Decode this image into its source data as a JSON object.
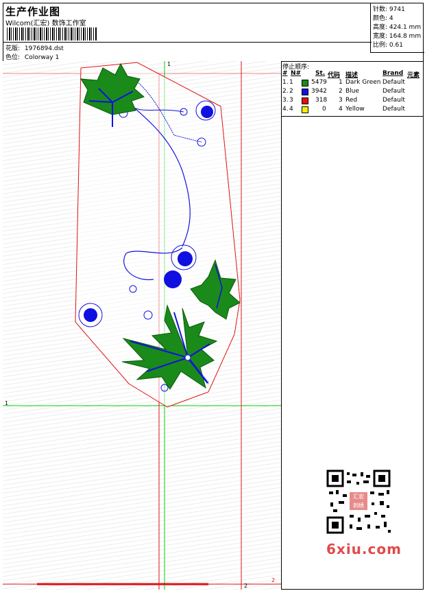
{
  "header": {
    "title": "生产作业图",
    "subtitle": "Wilcom(汇宏) 数饰工作室",
    "design_label": "花版:",
    "design_value": "1976894.dst",
    "colorway_label": "色位:",
    "colorway_value": "Colorway 1"
  },
  "stats": [
    {
      "label": "针数:",
      "value": "9741"
    },
    {
      "label": "颜色:",
      "value": "4"
    },
    {
      "label": "高度:",
      "value": "424.1 mm"
    },
    {
      "label": "宽度:",
      "value": "164.8 mm"
    },
    {
      "label": "比例:",
      "value": "0.61"
    }
  ],
  "legend": {
    "title": "停止顺序:",
    "columns": [
      "#",
      "N#",
      "St.",
      "代码",
      "描述",
      "Brand",
      "元素"
    ],
    "rows": [
      {
        "num": "1.",
        "n": "1",
        "color": "#1a8a1a",
        "st": "5479",
        "code": "1",
        "desc": "Dark Green",
        "brand": "Default"
      },
      {
        "num": "2.",
        "n": "2",
        "color": "#1010e0",
        "st": "3942",
        "code": "2",
        "desc": "Blue",
        "brand": "Default"
      },
      {
        "num": "3.",
        "n": "3",
        "color": "#e01010",
        "st": "318",
        "code": "3",
        "desc": "Red",
        "brand": "Default"
      },
      {
        "num": "4.",
        "n": "4",
        "color": "#f0f000",
        "st": "0",
        "code": "4",
        "desc": "Yellow",
        "brand": "Default"
      }
    ]
  },
  "canvas": {
    "marker_top": "1",
    "marker_left": "1",
    "marker_bottom": "2",
    "marker_corner": "2"
  },
  "watermark": {
    "stamp": "汇宏 刺绣",
    "site": "6xiu.com"
  }
}
